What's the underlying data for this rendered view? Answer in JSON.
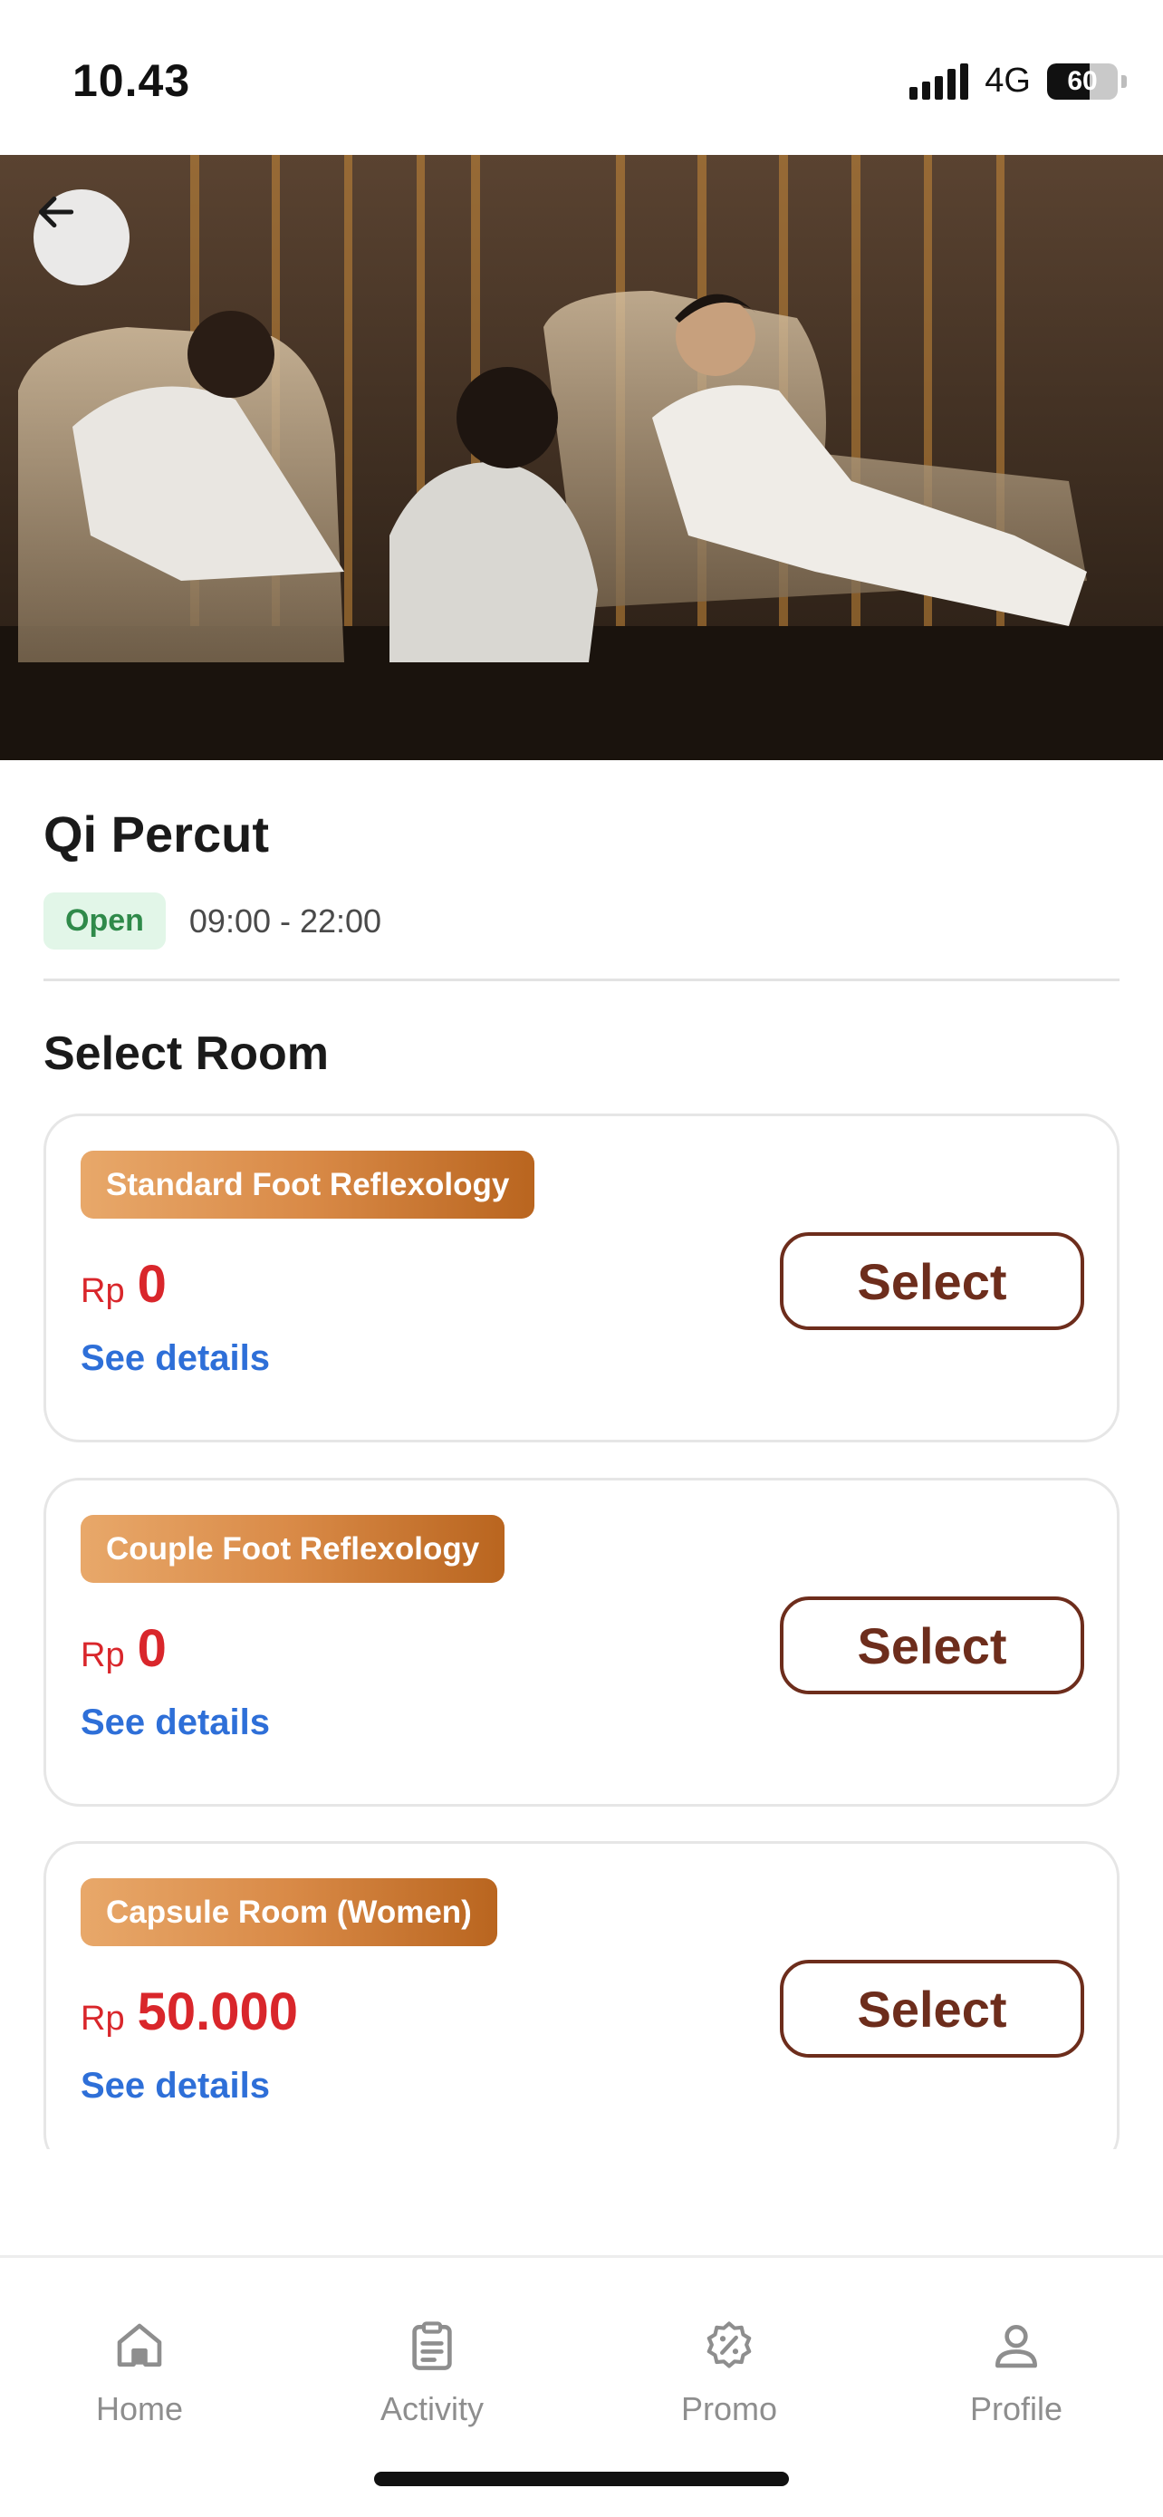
{
  "status_bar": {
    "time": "10.43",
    "network": "4G",
    "battery": "60",
    "battery_level": 0.6
  },
  "venue": {
    "name": "Qi Percut",
    "status": "Open",
    "hours": "09:00 - 22:00"
  },
  "section_title": "Select Room",
  "rooms": [
    {
      "name": "Standard Foot Reflexology",
      "currency": "Rp",
      "price": "0",
      "details_label": "See details",
      "select_label": "Select"
    },
    {
      "name": "Couple Foot Reflexology",
      "currency": "Rp",
      "price": "0",
      "details_label": "See details",
      "select_label": "Select"
    },
    {
      "name": "Capsule Room (Women)",
      "currency": "Rp",
      "price": "50.000",
      "details_label": "See details",
      "select_label": "Select"
    }
  ],
  "nav": [
    {
      "label": "Home",
      "icon": "home-icon"
    },
    {
      "label": "Activity",
      "icon": "clipboard-icon"
    },
    {
      "label": "Promo",
      "icon": "promo-badge-icon"
    },
    {
      "label": "Profile",
      "icon": "person-icon"
    }
  ],
  "colors": {
    "price": "#d9262b",
    "link": "#2e6fd8",
    "button_border": "#6d2d1c",
    "badge_gradient_start": "#e8a86a",
    "badge_gradient_end": "#b9651f",
    "open_badge_bg": "#e2f6e8",
    "open_badge_text": "#2f8a4a"
  }
}
